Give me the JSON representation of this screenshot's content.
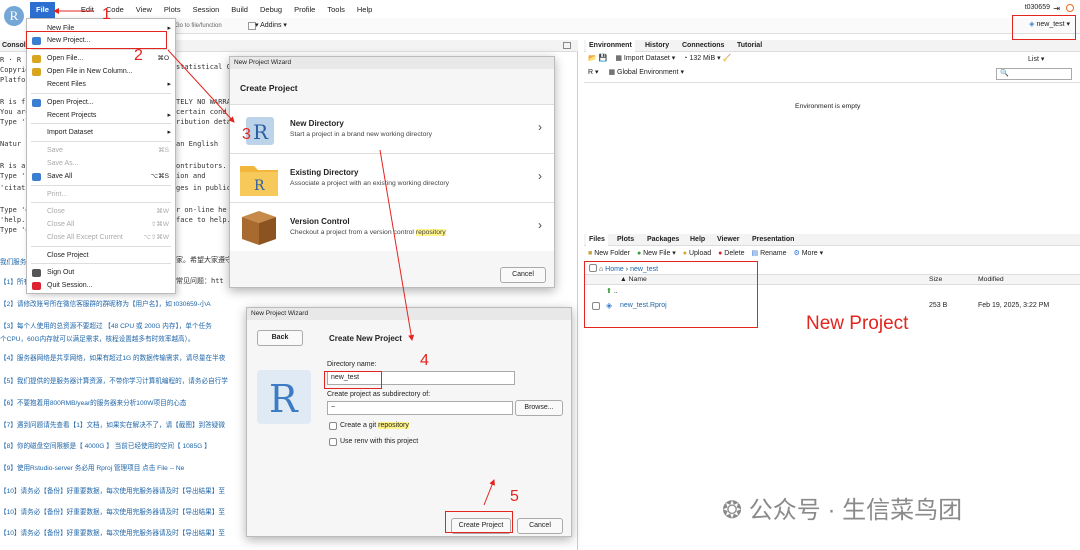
{
  "app": {
    "logo": "R",
    "menus": [
      "File",
      "Edit",
      "Code",
      "View",
      "Plots",
      "Session",
      "Build",
      "Debug",
      "Profile",
      "Tools",
      "Help"
    ],
    "user": "t030659",
    "project": "new_test",
    "goto_placeholder": "Go to file/function",
    "addins_label": "Addins"
  },
  "console": {
    "tab_label": "Console",
    "lines": [
      "R · R",
      "Copyright (",
      "Platform",
      "",
      "R is fr",
      "You are",
      "Type 'l",
      "",
      "  Natur",
      "",
      "R is a",
      "Type 'c",
      "'citati",
      "",
      "Type 'd",
      "'help.s",
      "Type 'q"
    ],
    "partial_right": [
      "statistical C",
      "TELY NO WARRA",
      "certain cond",
      "ribution deta",
      "an English",
      "ontributors.",
      "ion and",
      "ges in public",
      "r on-line he",
      "face to help.",
      "家。希望大家遵守",
      "常见问题：htt"
    ],
    "notes": [
      "我们服务",
      "【1】所有",
      "【2】请修改账号所在微信客服群的群昵称为【用户名】，如 t030659-小A",
      "【3】每个人使用的总资源不要超过 【48 CPU 或 200G 内存】，单个任务",
      "个CPU，60G内存就可以满足需求，核程设置越多有时效率越高）。",
      "【4】服务器网络是共享网络，如果有超过1G 的数据传输需求，请尽量在半夜",
      "【5】我们提供的是服务器计算资源，不带你学习计算机编程的，请务必自行学",
      "【6】不要抱着用800RMB/year的服务器来分析100W项目的心态",
      "【7】遇到问题请先查看【1】文档，如果实在解决不了，请【截图】到答疑微",
      "【8】你的磁盘空间限额是【 4000G 】    当前已经使用的空间【 1085G 】",
      "【9】使用Rstudio-server 务必用 Rproj 管理项目 点击 File -- Ne",
      "【10】请务必【备份】好重要数据，每次使用完服务器请及时【导出结果】至",
      "【10】请务必【备份】好重要数据，每次使用完服务器请及时【导出结果】至",
      "【10】请务必【备份】好重要数据，每次使用完服务器请及时【导出结果】至"
    ]
  },
  "file_menu": {
    "items": [
      {
        "label": "New File",
        "shortcut": "",
        "arrow": true,
        "disabled": false
      },
      {
        "label": "New Project...",
        "shortcut": "",
        "arrow": false,
        "disabled": false
      },
      {
        "label": "Open File...",
        "shortcut": "⌘O",
        "arrow": false,
        "disabled": false
      },
      {
        "label": "Open File in New Column...",
        "shortcut": "",
        "arrow": false,
        "disabled": false
      },
      {
        "label": "Recent Files",
        "shortcut": "",
        "arrow": true,
        "disabled": false
      },
      {
        "label": "Open Project...",
        "shortcut": "",
        "arrow": false,
        "disabled": false
      },
      {
        "label": "Recent Projects",
        "shortcut": "",
        "arrow": true,
        "disabled": false
      },
      {
        "label": "Import Dataset",
        "shortcut": "",
        "arrow": true,
        "disabled": false
      },
      {
        "label": "Save",
        "shortcut": "⌘S",
        "arrow": false,
        "disabled": true
      },
      {
        "label": "Save As...",
        "shortcut": "",
        "arrow": false,
        "disabled": true
      },
      {
        "label": "Save All",
        "shortcut": "⌥⌘S",
        "arrow": false,
        "disabled": false
      },
      {
        "label": "Print...",
        "shortcut": "",
        "arrow": false,
        "disabled": true
      },
      {
        "label": "Close",
        "shortcut": "⌘W",
        "arrow": false,
        "disabled": true
      },
      {
        "label": "Close All",
        "shortcut": "⇧⌘W",
        "arrow": false,
        "disabled": true
      },
      {
        "label": "Close All Except Current",
        "shortcut": "⌥⇧⌘W",
        "arrow": false,
        "disabled": true
      },
      {
        "label": "Close Project",
        "shortcut": "",
        "arrow": false,
        "disabled": false
      },
      {
        "label": "Sign Out",
        "shortcut": "",
        "arrow": false,
        "disabled": false
      },
      {
        "label": "Quit Session...",
        "shortcut": "",
        "arrow": false,
        "disabled": false
      }
    ]
  },
  "wizard1": {
    "title": "New Project Wizard",
    "heading": "Create Project",
    "options": [
      {
        "title": "New Directory",
        "subtitle": "Start a project in a brand new working directory"
      },
      {
        "title": "Existing Directory",
        "subtitle": "Associate a project with an existing working directory"
      },
      {
        "title": "Version Control",
        "subtitle_pre": "Checkout a project from a version control ",
        "subtitle_hl": "repository"
      }
    ],
    "cancel": "Cancel"
  },
  "wizard2": {
    "title": "New Project Wizard",
    "back": "Back",
    "heading": "Create New Project",
    "dir_label": "Directory name:",
    "dir_value": "new_test",
    "sub_label": "Create project as subdirectory of:",
    "sub_value": "~",
    "browse": "Browse...",
    "git_pre": "Create a git ",
    "git_hl": "repository",
    "renv": "Use renv with this project",
    "create": "Create Project",
    "cancel": "Cancel"
  },
  "env_pane": {
    "tabs": [
      "Environment",
      "History",
      "Connections",
      "Tutorial"
    ],
    "import_label": "Import Dataset",
    "memory": "132 MiB",
    "list_label": "List",
    "lang": "R",
    "global_env": "Global Environment",
    "empty_text": "Environment is empty"
  },
  "files_pane": {
    "tabs": [
      "Files",
      "Plots",
      "Packages",
      "Help",
      "Viewer",
      "Presentation"
    ],
    "toolbar": [
      "New Folder",
      "New File",
      "Upload",
      "Delete",
      "Rename",
      "More"
    ],
    "breadcrumb": [
      "Home",
      "new_test"
    ],
    "columns": [
      "Name",
      "Size",
      "Modified"
    ],
    "up": "..",
    "rows": [
      {
        "name": "new_test.Rproj",
        "size": "253 B",
        "modified": "Feb 19, 2025, 3:22 PM"
      }
    ]
  },
  "annotations": {
    "numbers": [
      "1",
      "2",
      "3",
      "4",
      "5"
    ],
    "new_project_label": "New Project",
    "watermark": "公众号 · 生信菜鸟团"
  },
  "colors": {
    "accent": "#2c6fd1",
    "annotation": "#e4241f",
    "highlight": "#fff48a"
  }
}
